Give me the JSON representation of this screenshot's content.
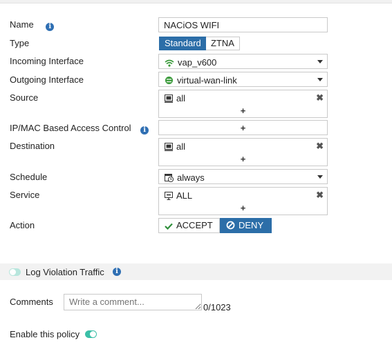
{
  "form": {
    "name": {
      "label": "Name",
      "value": "NACiOS WIFI"
    },
    "type": {
      "label": "Type",
      "options": [
        "Standard",
        "ZTNA"
      ],
      "selected": "Standard"
    },
    "incoming": {
      "label": "Incoming Interface",
      "value": "vap_v600",
      "icon": "wifi-interface-icon"
    },
    "outgoing": {
      "label": "Outgoing Interface",
      "value": "virtual-wan-link",
      "icon": "sdwan-icon"
    },
    "source": {
      "label": "Source",
      "value": "all",
      "icon": "address-icon"
    },
    "ipmac": {
      "label": "IP/MAC Based Access Control"
    },
    "destination": {
      "label": "Destination",
      "value": "all",
      "icon": "address-icon"
    },
    "schedule": {
      "label": "Schedule",
      "value": "always",
      "icon": "schedule-icon"
    },
    "service": {
      "label": "Service",
      "value": "ALL",
      "icon": "service-icon"
    },
    "action": {
      "label": "Action",
      "accept": "ACCEPT",
      "deny": "DENY",
      "selected": "DENY"
    },
    "plus": "+",
    "remove": "✖"
  },
  "log": {
    "label": "Log Violation Traffic",
    "enabled": true
  },
  "comments": {
    "label": "Comments",
    "placeholder": "Write a comment...",
    "counter": "0/1023"
  },
  "enable": {
    "label": "Enable this policy",
    "enabled": true
  },
  "colors": {
    "accent": "#2c6ea8",
    "toggle_on": "#3bbfa7",
    "toggle_off": "#b8e6dd",
    "info": "#2f6fb3",
    "accept_check": "#2f8f3b"
  }
}
